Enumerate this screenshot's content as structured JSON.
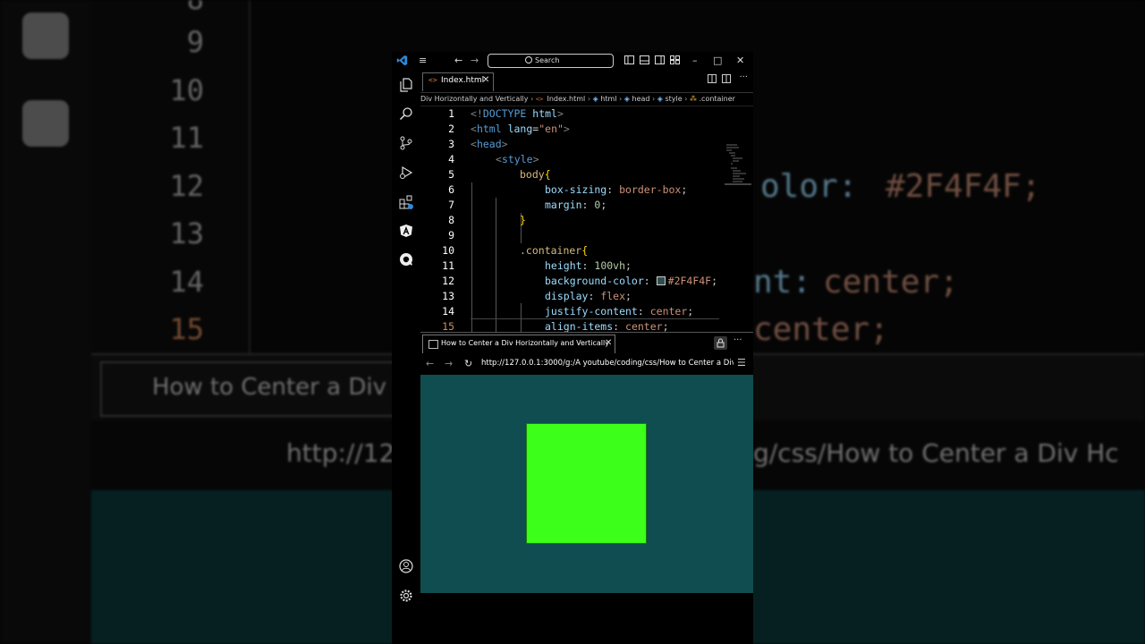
{
  "background_zoom": {
    "line_numbers": [
      "8",
      "9",
      "10",
      "11",
      "12",
      "13",
      "14",
      "15"
    ],
    "code_fragments": [
      "olor:",
      "#2F4F4F;",
      "nt:",
      "center;",
      "center;"
    ],
    "tab_title": "How to Center a Div H",
    "url_left": "http://127",
    "url_right": "g/css/How to Center a Div Hc"
  },
  "titlebar": {
    "search_label": "Search",
    "menu_glyph": "≡",
    "back_glyph": "←",
    "forward_glyph": "→",
    "minimize_glyph": "–",
    "maximize_glyph": "□",
    "close_glyph": "✕"
  },
  "editor": {
    "tab": {
      "label": "Index.html",
      "close": "✕"
    },
    "breadcrumb": [
      "Div Horizontally and Vertically",
      "Index.html",
      "html",
      "head",
      "style",
      ".container"
    ],
    "lines": [
      {
        "n": "1"
      },
      {
        "n": "2"
      },
      {
        "n": "3"
      },
      {
        "n": "4"
      },
      {
        "n": "5"
      },
      {
        "n": "6"
      },
      {
        "n": "7"
      },
      {
        "n": "8"
      },
      {
        "n": "9"
      },
      {
        "n": "10"
      },
      {
        "n": "11"
      },
      {
        "n": "12"
      },
      {
        "n": "13"
      },
      {
        "n": "14"
      },
      {
        "n": "15"
      }
    ],
    "code": {
      "doctype_open": "<!",
      "doctype_kw": "DOCTYPE",
      "doctype_html": "html",
      "doctype_close": ">",
      "html_lt": "<",
      "html_tag": "html",
      "lang_attr": "lang",
      "eq": "=",
      "lang_val": "\"en\"",
      "gt": ">",
      "head_tag": "head",
      "style_tag": "style",
      "body_sel": "body",
      "brace_open": "{",
      "brace_close": "}",
      "box_sizing_prop": "box-sizing",
      "box_sizing_val": "border-box",
      "margin_prop": "margin",
      "margin_val": "0",
      "container_sel": ".container",
      "height_prop": "height",
      "height_val": "100vh",
      "bgc_prop": "background-color",
      "bgc_val": "#2F4F4F",
      "display_prop": "display",
      "display_val": "flex",
      "jc_prop": "justify-content",
      "jc_val": "center",
      "ai_prop": "align-items",
      "ai_val": "center",
      "colon": ": ",
      "semi": ";"
    }
  },
  "browser": {
    "tab_title": "How to Center a Div Horizontally and Vertically",
    "tab_close": "✕",
    "url": "http://127.0.0.1:3000/g:/A youtube/coding/css/How to Center a Div Hc",
    "page_bg": "#0f4d50",
    "box_color": "#3cff1a"
  },
  "colors": {
    "vscode_blue": "#2f8ad8"
  }
}
